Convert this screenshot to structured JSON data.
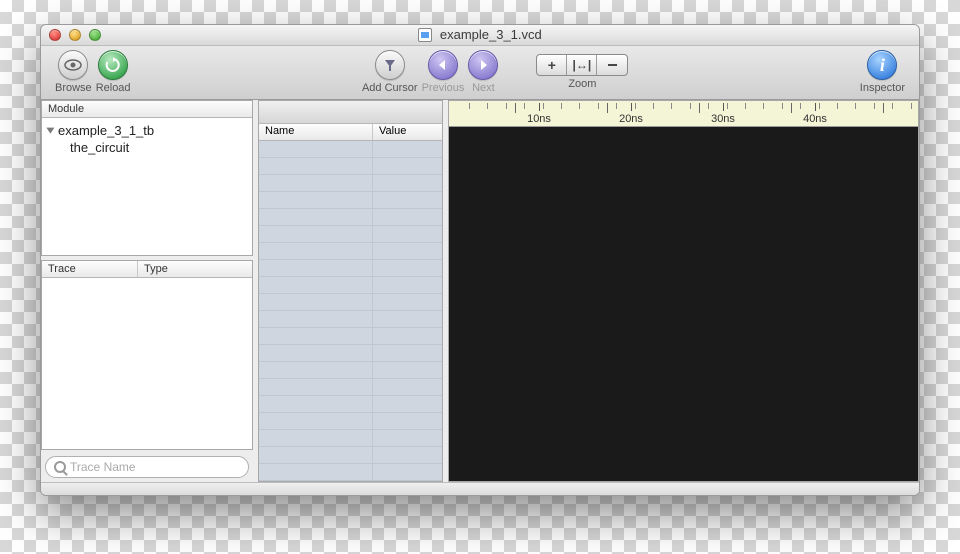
{
  "window": {
    "title": "example_3_1.vcd"
  },
  "toolbar": {
    "browse": "Browse",
    "reload": "Reload",
    "addcursor": "Add Cursor",
    "previous": "Previous",
    "next": "Next",
    "zoom": "Zoom",
    "inspector": "Inspector"
  },
  "left": {
    "module_header": "Module",
    "tree_root": "example_3_1_tb",
    "tree_child": "the_circuit",
    "trace_header": "Trace",
    "type_header": "Type",
    "search_placeholder": "Trace Name"
  },
  "mid": {
    "name_header": "Name",
    "value_header": "Value"
  },
  "ruler": {
    "labels": [
      "10ns",
      "20ns",
      "30ns",
      "40ns"
    ]
  }
}
